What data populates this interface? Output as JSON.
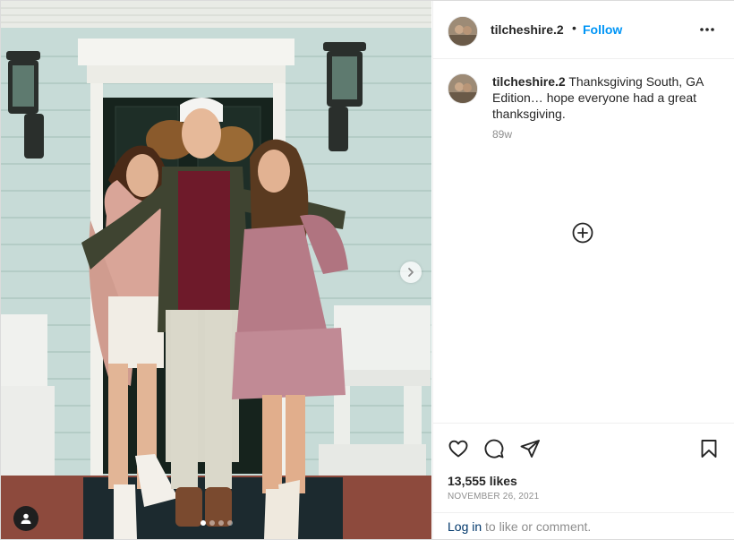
{
  "post": {
    "username": "tilcheshire.2",
    "separator": "•",
    "follow_label": "Follow",
    "more_icon": "more-horizontal-icon"
  },
  "caption": {
    "username": "tilcheshire.2",
    "text": "Thanksgiving South, GA Edition… hope everyone had a great thanksgiving.",
    "time": "89w",
    "load_more_icon": "plus-circle-icon"
  },
  "actions": {
    "like_icon": "heart-icon",
    "comment_icon": "comment-icon",
    "share_icon": "paper-plane-icon",
    "save_icon": "bookmark-icon"
  },
  "likes_text": "13,555 likes",
  "date_text": "NOVEMBER 26, 2021",
  "login": {
    "link_label": "Log in",
    "suffix": " to like or comment."
  },
  "media": {
    "carousel_slides": 4,
    "active_slide": 1,
    "next_icon": "chevron-right-icon",
    "tag_icon": "user-tag-icon"
  },
  "colors": {
    "follow": "#0095f6",
    "text": "#262626",
    "secondary": "#8e8e8e",
    "link": "#00376b"
  }
}
